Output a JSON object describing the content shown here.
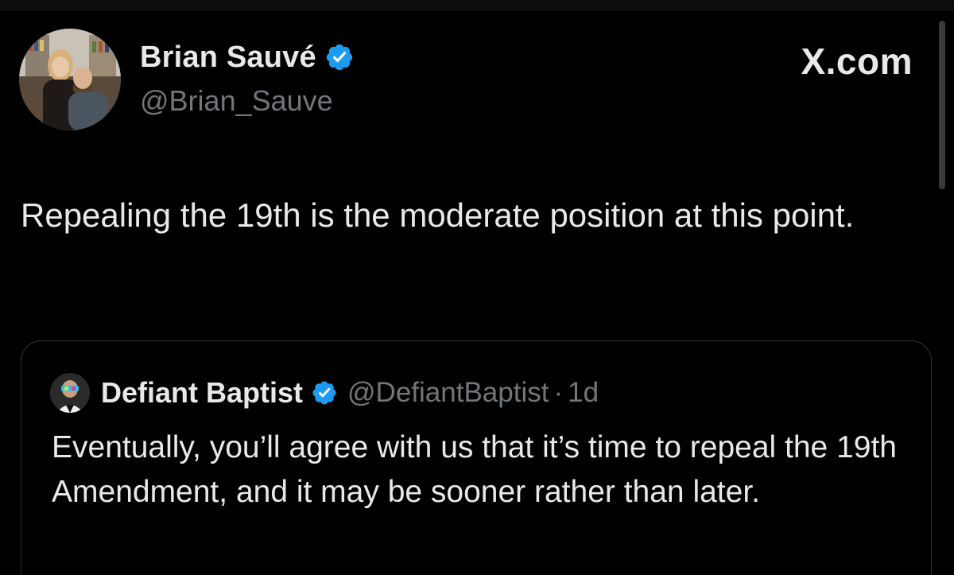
{
  "brand": {
    "label": "X.com"
  },
  "tweet": {
    "author": {
      "name": "Brian Sauvé",
      "handle": "@Brian_Sauve",
      "verified": true
    },
    "text": "Repealing the 19th is the moderate position at this point."
  },
  "quoted_tweet": {
    "author": {
      "name": "Defiant Baptist",
      "handle": "@DefiantBaptist",
      "verified": true
    },
    "separator": "·",
    "time": "1d",
    "text": "Eventually, you’ll agree with us that it’s time to repeal the 19th Amendment, and it may be sooner rather than later."
  },
  "colors": {
    "background": "#000000",
    "text_primary": "#e7e9ea",
    "text_secondary": "#71767b",
    "verified_badge": "#1d9bf0",
    "border": "#2f3336"
  },
  "icons": {
    "verified": "verified-badge-icon"
  }
}
